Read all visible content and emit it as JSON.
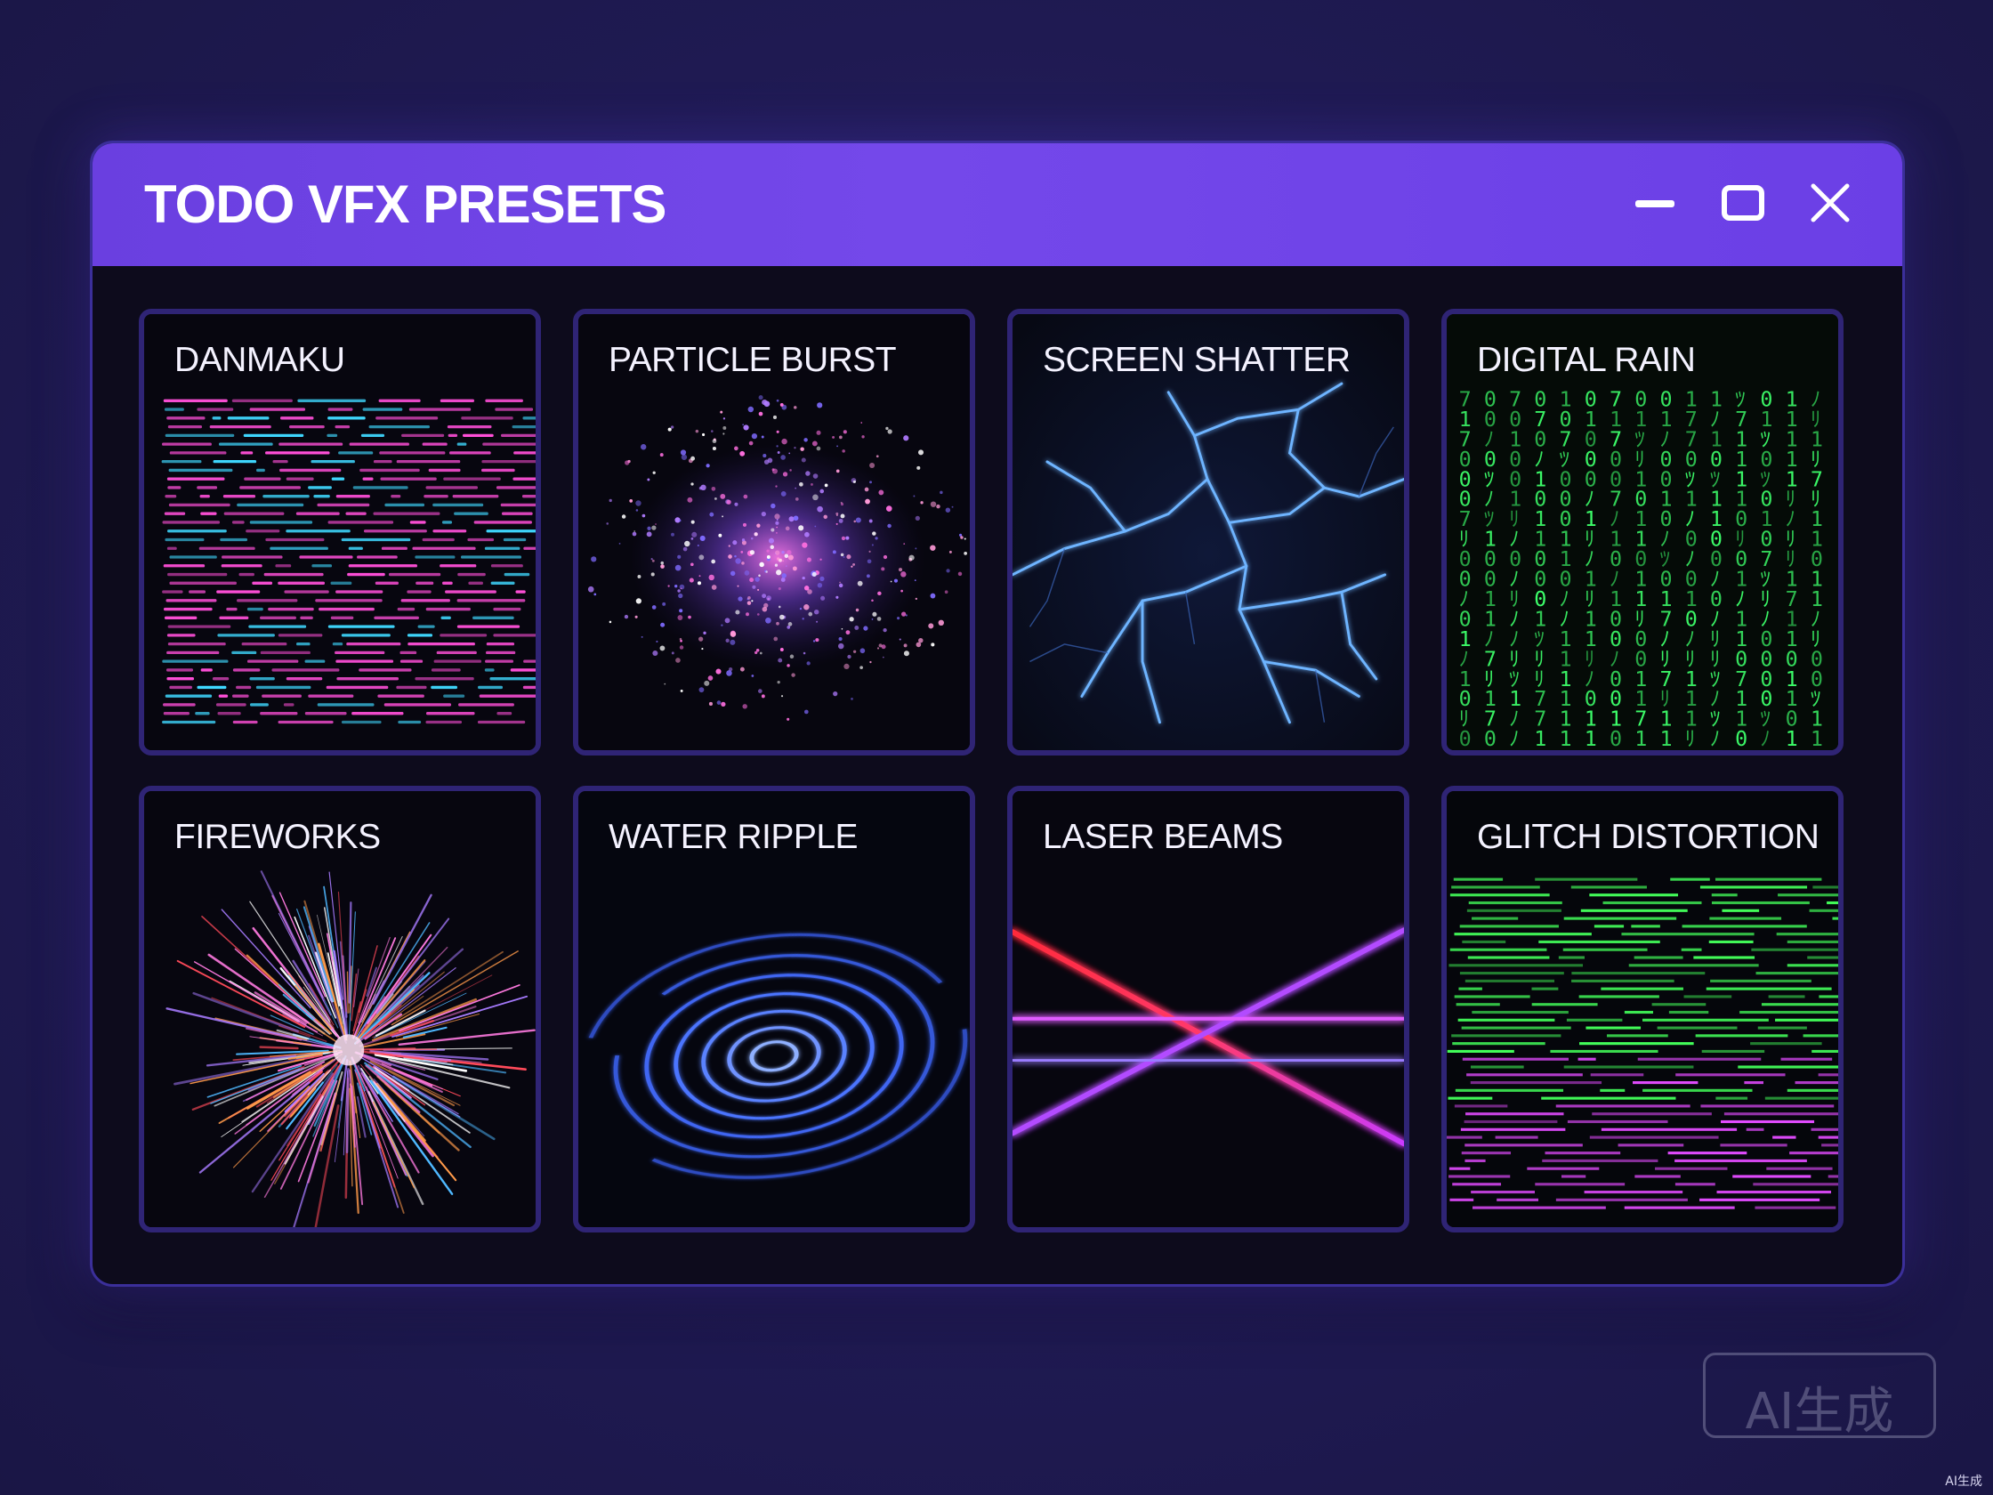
{
  "window": {
    "title": "TODO VFX PRESETS"
  },
  "presets": [
    {
      "label": "DANMAKU",
      "icon": "danmaku-preview"
    },
    {
      "label": "PARTICLE BURST",
      "icon": "particle-burst-preview"
    },
    {
      "label": "SCREEN SHATTER",
      "icon": "screen-shatter-preview"
    },
    {
      "label": "DIGITAL RAIN",
      "icon": "digital-rain-preview"
    },
    {
      "label": "FIREWORKS",
      "icon": "fireworks-preview"
    },
    {
      "label": "WATER RIPPLE",
      "icon": "water-ripple-preview"
    },
    {
      "label": "LASER BEAMS",
      "icon": "laser-beams-preview"
    },
    {
      "label": "GLITCH DISTORTION",
      "icon": "glitch-distortion-preview"
    }
  ],
  "watermark": {
    "badge_text": "AI生成",
    "corner_text": "AI生成"
  },
  "colors": {
    "titlebar": "#6f44e6",
    "window_bg": "#0d0b1c",
    "card_border": "#2f2475",
    "danmaku_pink": "#ff4fd8",
    "danmaku_cyan": "#3fd8ff",
    "rain_green": "#3dff6a",
    "shatter_blue": "#5aa8ff",
    "laser_red": "#ff2a3a",
    "laser_magenta": "#e24bff"
  }
}
